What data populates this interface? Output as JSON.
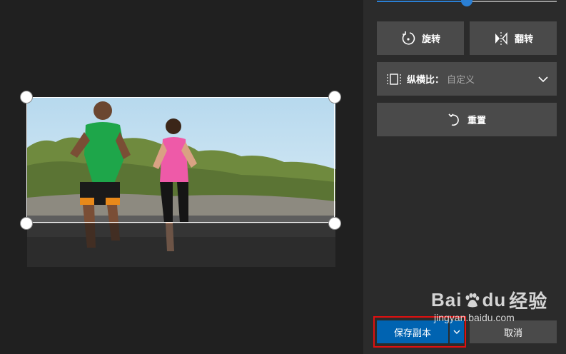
{
  "editor": {
    "slider": {
      "value_percent": 50
    },
    "rotate_label": "旋转",
    "flip_label": "翻转",
    "aspect": {
      "label": "纵横比：",
      "value": "自定义"
    },
    "reset_label": "重置",
    "save_label": "保存副本",
    "cancel_label": "取消"
  },
  "watermark": {
    "main_left": "Bai",
    "main_right": "du",
    "main_cn": "经验",
    "sub": "jingyan.baidu.com"
  },
  "colors": {
    "accent": "#0063b1",
    "slider_accent": "#2a7fd4",
    "highlight": "#e01010",
    "panel_bg": "#2b2b2b",
    "button_bg": "#4a4a4a"
  },
  "icons": {
    "rotate": "rotate-icon",
    "flip": "flip-icon",
    "aspect": "aspect-ratio-icon",
    "chevron": "chevron-down-icon",
    "reset": "undo-icon"
  }
}
